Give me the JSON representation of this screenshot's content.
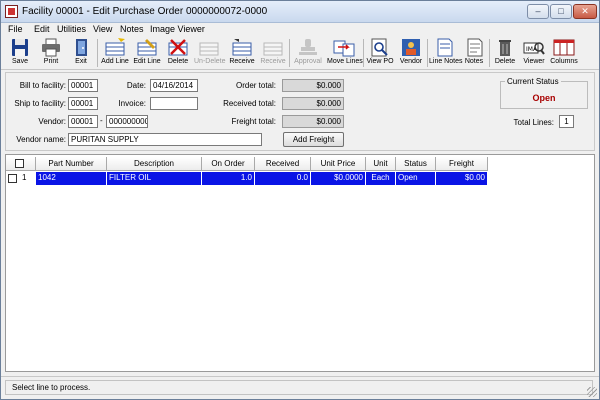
{
  "window": {
    "title": "Facility 00001 - Edit Purchase Order 0000000072-0000",
    "min_glyph": "–",
    "max_glyph": "□",
    "close_glyph": "✕"
  },
  "menu": [
    "File",
    "Edit",
    "Utilities",
    "View",
    "Notes",
    "Image Viewer"
  ],
  "toolbar": {
    "save": "Save",
    "print": "Print",
    "exit": "Exit",
    "add_line": "Add Line",
    "edit_line": "Edit Line",
    "delete_line": "Delete",
    "undelete": "Un-Delete",
    "receive": "Receive",
    "receive_disabled": "Receive",
    "approval": "Approval",
    "move_lines": "Move Lines",
    "view_po": "View PO",
    "vendor": "Vendor",
    "line_notes": "Line Notes",
    "notes": "Notes",
    "delete": "Delete",
    "viewer": "Viewer",
    "columns": "Columns"
  },
  "header": {
    "bill_to_label": "Bill to facility:",
    "bill_to_value": "00001",
    "ship_to_label": "Ship to facility:",
    "ship_to_value": "00001",
    "vendor_label": "Vendor:",
    "vendor_value_a": "00001",
    "vendor_dash": "-",
    "vendor_value_b": "0000000001",
    "vendor_name_label": "Vendor name:",
    "vendor_name_value": "PURITAN SUPPLY",
    "date_label": "Date:",
    "date_value": "04/16/2014",
    "invoice_label": "Invoice:",
    "invoice_value": "",
    "order_total_label": "Order total:",
    "order_total_value": "$0.000",
    "received_total_label": "Received total:",
    "received_total_value": "$0.000",
    "freight_total_label": "Freight total:",
    "freight_total_value": "$0.000",
    "add_freight_label": "Add Freight",
    "current_status_label": "Current Status",
    "current_status_value": "Open",
    "total_lines_label": "Total Lines:",
    "total_lines_value": "1"
  },
  "grid": {
    "columns": [
      "Part Number",
      "Description",
      "On Order",
      "Received",
      "Unit Price",
      "Unit",
      "Status",
      "Freight"
    ],
    "rows": [
      {
        "index": "1",
        "part_number": "1042",
        "description": "FILTER OIL",
        "on_order": "1.0",
        "received": "0.0",
        "unit_price": "$0.0000",
        "unit": "Each",
        "status": "Open",
        "freight": "$0.00"
      }
    ]
  },
  "statusbar": {
    "message": "Select line to process."
  },
  "colors": {
    "selection": "#0a14e6",
    "status_open": "#a80000"
  }
}
